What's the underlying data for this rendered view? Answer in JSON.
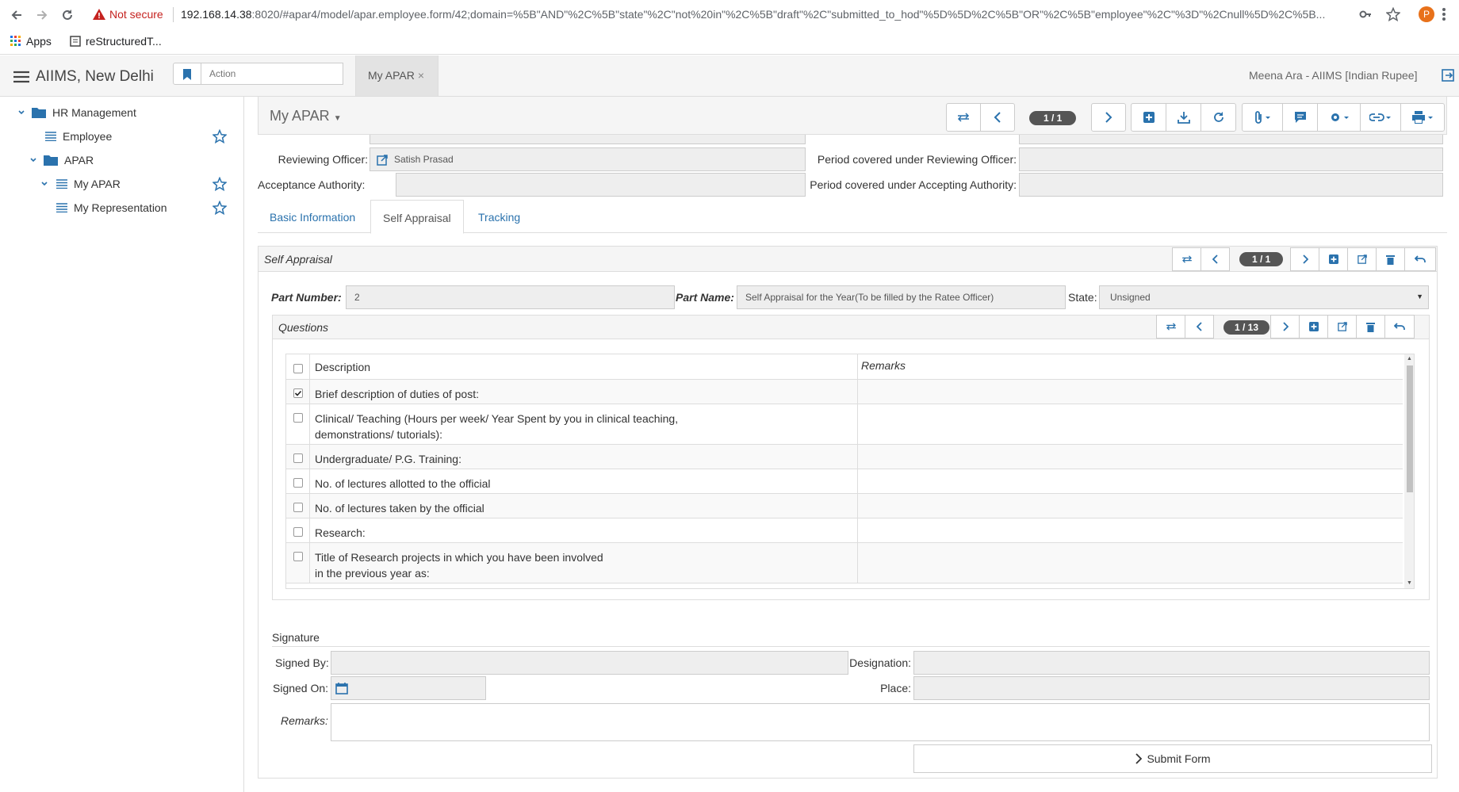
{
  "browser": {
    "security_label": "Not secure",
    "url_host": "192.168.14.38",
    "url_rest": ":8020/#apar4/model/apar.employee.form/42;domain=%5B\"AND\"%2C%5B\"state\"%2C\"not%20in\"%2C%5B\"draft\"%2C\"submitted_to_hod\"%5D%5D%2C%5B\"OR\"%2C%5B\"employee\"%2C\"%3D\"%2Cnull%5D%2C%5B...",
    "profile_initial": "P",
    "bookmarks": [
      "Apps",
      "reStructuredT..."
    ]
  },
  "app": {
    "company": "AIIMS, New Delhi",
    "action_placeholder": "Action",
    "open_tab": "My APAR",
    "close_glyph": "×",
    "user": "Meena Ara - AIIMS [Indian Rupee]"
  },
  "sidebar": {
    "items": [
      {
        "label": "HR Management",
        "icon": "folder-icon"
      },
      {
        "label": "Employee",
        "icon": "list-icon"
      },
      {
        "label": "APAR",
        "icon": "folder-icon"
      },
      {
        "label": "My APAR",
        "icon": "list-icon"
      },
      {
        "label": "My Representation",
        "icon": "list-icon"
      }
    ]
  },
  "form": {
    "title": "My APAR",
    "record_badge": "1 / 1",
    "reviewing_officer_label": "Reviewing Officer:",
    "reviewing_officer_value": "Satish Prasad",
    "acceptance_authority_label": "Acceptance Authority:",
    "period_reviewing_label": "Period covered under Reviewing Officer:",
    "period_accepting_label": "Period covered under Accepting Authority:",
    "tabs": [
      "Basic Information",
      "Self Appraisal",
      "Tracking"
    ],
    "active_tab": "Self Appraisal"
  },
  "self_appraisal": {
    "title": "Self Appraisal",
    "badge": "1 / 1",
    "part_number_label": "Part Number:",
    "part_number_value": "2",
    "part_name_label": "Part Name:",
    "part_name_value": "Self Appraisal for the Year(To be filled by the Ratee Officer)",
    "state_label": "State:",
    "state_value": "Unsigned"
  },
  "questions": {
    "title": "Questions",
    "badge": "1 / 13",
    "col_description": "Description",
    "col_remarks": "Remarks",
    "rows": [
      {
        "desc": "Brief description of duties of post:",
        "checked": true
      },
      {
        "desc": "Clinical/ Teaching (Hours per week/ Year Spent by you in clinical teaching,\n demonstrations/ tutorials):",
        "checked": false
      },
      {
        "desc": "Undergraduate/ P.G. Training:",
        "checked": false
      },
      {
        "desc": "No. of lectures allotted to the official",
        "checked": false
      },
      {
        "desc": "No. of lectures taken by the official",
        "checked": false
      },
      {
        "desc": "Research:",
        "checked": false
      },
      {
        "desc": "Title of Research projects in which you have been involved\n in the previous year as:",
        "checked": false
      }
    ]
  },
  "signature": {
    "title": "Signature",
    "signed_by_label": "Signed By:",
    "designation_label": "Designation:",
    "signed_on_label": "Signed On:",
    "place_label": "Place:",
    "remarks_label": "Remarks:",
    "submit_label": "Submit Form"
  }
}
